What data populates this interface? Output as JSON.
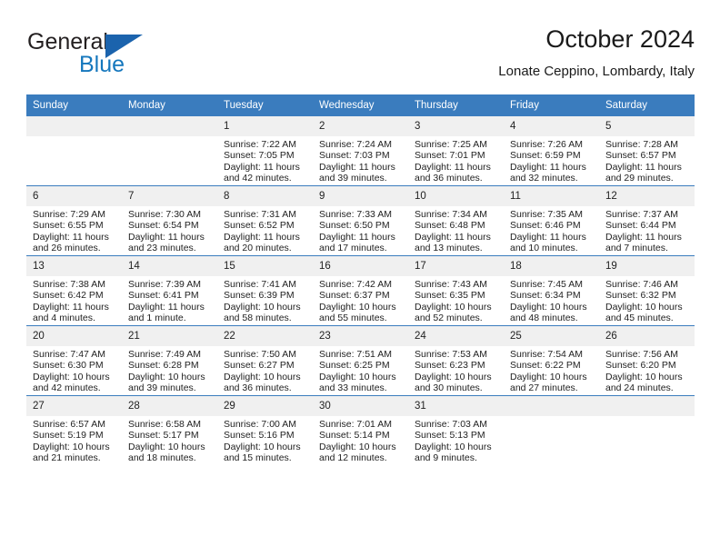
{
  "brand": {
    "name_top": "General",
    "name_bottom": "Blue",
    "triangle_icon": "triangle-logo-icon",
    "colors": {
      "dark": "#231f20",
      "blue": "#1577bd",
      "triangle": "#1b63ad"
    }
  },
  "header": {
    "month_title": "October 2024",
    "location": "Lonate Ceppino, Lombardy, Italy"
  },
  "calendar": {
    "header_bg": "#3a7cbe",
    "daynum_bg": "#f0f0f0",
    "weekday_headers": [
      "Sunday",
      "Monday",
      "Tuesday",
      "Wednesday",
      "Thursday",
      "Friday",
      "Saturday"
    ],
    "labels": {
      "sunrise_prefix": "Sunrise:",
      "sunset_prefix": "Sunset:",
      "daylight_prefix": "Daylight:"
    },
    "weeks": [
      [
        {
          "day": "",
          "sunrise": "",
          "sunset": "",
          "daylight_line1": "",
          "daylight_line2": ""
        },
        {
          "day": "",
          "sunrise": "",
          "sunset": "",
          "daylight_line1": "",
          "daylight_line2": ""
        },
        {
          "day": "1",
          "sunrise": "Sunrise: 7:22 AM",
          "sunset": "Sunset: 7:05 PM",
          "daylight_line1": "Daylight: 11 hours",
          "daylight_line2": "and 42 minutes."
        },
        {
          "day": "2",
          "sunrise": "Sunrise: 7:24 AM",
          "sunset": "Sunset: 7:03 PM",
          "daylight_line1": "Daylight: 11 hours",
          "daylight_line2": "and 39 minutes."
        },
        {
          "day": "3",
          "sunrise": "Sunrise: 7:25 AM",
          "sunset": "Sunset: 7:01 PM",
          "daylight_line1": "Daylight: 11 hours",
          "daylight_line2": "and 36 minutes."
        },
        {
          "day": "4",
          "sunrise": "Sunrise: 7:26 AM",
          "sunset": "Sunset: 6:59 PM",
          "daylight_line1": "Daylight: 11 hours",
          "daylight_line2": "and 32 minutes."
        },
        {
          "day": "5",
          "sunrise": "Sunrise: 7:28 AM",
          "sunset": "Sunset: 6:57 PM",
          "daylight_line1": "Daylight: 11 hours",
          "daylight_line2": "and 29 minutes."
        }
      ],
      [
        {
          "day": "6",
          "sunrise": "Sunrise: 7:29 AM",
          "sunset": "Sunset: 6:55 PM",
          "daylight_line1": "Daylight: 11 hours",
          "daylight_line2": "and 26 minutes."
        },
        {
          "day": "7",
          "sunrise": "Sunrise: 7:30 AM",
          "sunset": "Sunset: 6:54 PM",
          "daylight_line1": "Daylight: 11 hours",
          "daylight_line2": "and 23 minutes."
        },
        {
          "day": "8",
          "sunrise": "Sunrise: 7:31 AM",
          "sunset": "Sunset: 6:52 PM",
          "daylight_line1": "Daylight: 11 hours",
          "daylight_line2": "and 20 minutes."
        },
        {
          "day": "9",
          "sunrise": "Sunrise: 7:33 AM",
          "sunset": "Sunset: 6:50 PM",
          "daylight_line1": "Daylight: 11 hours",
          "daylight_line2": "and 17 minutes."
        },
        {
          "day": "10",
          "sunrise": "Sunrise: 7:34 AM",
          "sunset": "Sunset: 6:48 PM",
          "daylight_line1": "Daylight: 11 hours",
          "daylight_line2": "and 13 minutes."
        },
        {
          "day": "11",
          "sunrise": "Sunrise: 7:35 AM",
          "sunset": "Sunset: 6:46 PM",
          "daylight_line1": "Daylight: 11 hours",
          "daylight_line2": "and 10 minutes."
        },
        {
          "day": "12",
          "sunrise": "Sunrise: 7:37 AM",
          "sunset": "Sunset: 6:44 PM",
          "daylight_line1": "Daylight: 11 hours",
          "daylight_line2": "and 7 minutes."
        }
      ],
      [
        {
          "day": "13",
          "sunrise": "Sunrise: 7:38 AM",
          "sunset": "Sunset: 6:42 PM",
          "daylight_line1": "Daylight: 11 hours",
          "daylight_line2": "and 4 minutes."
        },
        {
          "day": "14",
          "sunrise": "Sunrise: 7:39 AM",
          "sunset": "Sunset: 6:41 PM",
          "daylight_line1": "Daylight: 11 hours",
          "daylight_line2": "and 1 minute."
        },
        {
          "day": "15",
          "sunrise": "Sunrise: 7:41 AM",
          "sunset": "Sunset: 6:39 PM",
          "daylight_line1": "Daylight: 10 hours",
          "daylight_line2": "and 58 minutes."
        },
        {
          "day": "16",
          "sunrise": "Sunrise: 7:42 AM",
          "sunset": "Sunset: 6:37 PM",
          "daylight_line1": "Daylight: 10 hours",
          "daylight_line2": "and 55 minutes."
        },
        {
          "day": "17",
          "sunrise": "Sunrise: 7:43 AM",
          "sunset": "Sunset: 6:35 PM",
          "daylight_line1": "Daylight: 10 hours",
          "daylight_line2": "and 52 minutes."
        },
        {
          "day": "18",
          "sunrise": "Sunrise: 7:45 AM",
          "sunset": "Sunset: 6:34 PM",
          "daylight_line1": "Daylight: 10 hours",
          "daylight_line2": "and 48 minutes."
        },
        {
          "day": "19",
          "sunrise": "Sunrise: 7:46 AM",
          "sunset": "Sunset: 6:32 PM",
          "daylight_line1": "Daylight: 10 hours",
          "daylight_line2": "and 45 minutes."
        }
      ],
      [
        {
          "day": "20",
          "sunrise": "Sunrise: 7:47 AM",
          "sunset": "Sunset: 6:30 PM",
          "daylight_line1": "Daylight: 10 hours",
          "daylight_line2": "and 42 minutes."
        },
        {
          "day": "21",
          "sunrise": "Sunrise: 7:49 AM",
          "sunset": "Sunset: 6:28 PM",
          "daylight_line1": "Daylight: 10 hours",
          "daylight_line2": "and 39 minutes."
        },
        {
          "day": "22",
          "sunrise": "Sunrise: 7:50 AM",
          "sunset": "Sunset: 6:27 PM",
          "daylight_line1": "Daylight: 10 hours",
          "daylight_line2": "and 36 minutes."
        },
        {
          "day": "23",
          "sunrise": "Sunrise: 7:51 AM",
          "sunset": "Sunset: 6:25 PM",
          "daylight_line1": "Daylight: 10 hours",
          "daylight_line2": "and 33 minutes."
        },
        {
          "day": "24",
          "sunrise": "Sunrise: 7:53 AM",
          "sunset": "Sunset: 6:23 PM",
          "daylight_line1": "Daylight: 10 hours",
          "daylight_line2": "and 30 minutes."
        },
        {
          "day": "25",
          "sunrise": "Sunrise: 7:54 AM",
          "sunset": "Sunset: 6:22 PM",
          "daylight_line1": "Daylight: 10 hours",
          "daylight_line2": "and 27 minutes."
        },
        {
          "day": "26",
          "sunrise": "Sunrise: 7:56 AM",
          "sunset": "Sunset: 6:20 PM",
          "daylight_line1": "Daylight: 10 hours",
          "daylight_line2": "and 24 minutes."
        }
      ],
      [
        {
          "day": "27",
          "sunrise": "Sunrise: 6:57 AM",
          "sunset": "Sunset: 5:19 PM",
          "daylight_line1": "Daylight: 10 hours",
          "daylight_line2": "and 21 minutes."
        },
        {
          "day": "28",
          "sunrise": "Sunrise: 6:58 AM",
          "sunset": "Sunset: 5:17 PM",
          "daylight_line1": "Daylight: 10 hours",
          "daylight_line2": "and 18 minutes."
        },
        {
          "day": "29",
          "sunrise": "Sunrise: 7:00 AM",
          "sunset": "Sunset: 5:16 PM",
          "daylight_line1": "Daylight: 10 hours",
          "daylight_line2": "and 15 minutes."
        },
        {
          "day": "30",
          "sunrise": "Sunrise: 7:01 AM",
          "sunset": "Sunset: 5:14 PM",
          "daylight_line1": "Daylight: 10 hours",
          "daylight_line2": "and 12 minutes."
        },
        {
          "day": "31",
          "sunrise": "Sunrise: 7:03 AM",
          "sunset": "Sunset: 5:13 PM",
          "daylight_line1": "Daylight: 10 hours",
          "daylight_line2": "and 9 minutes."
        },
        {
          "day": "",
          "sunrise": "",
          "sunset": "",
          "daylight_line1": "",
          "daylight_line2": ""
        },
        {
          "day": "",
          "sunrise": "",
          "sunset": "",
          "daylight_line1": "",
          "daylight_line2": ""
        }
      ]
    ]
  }
}
